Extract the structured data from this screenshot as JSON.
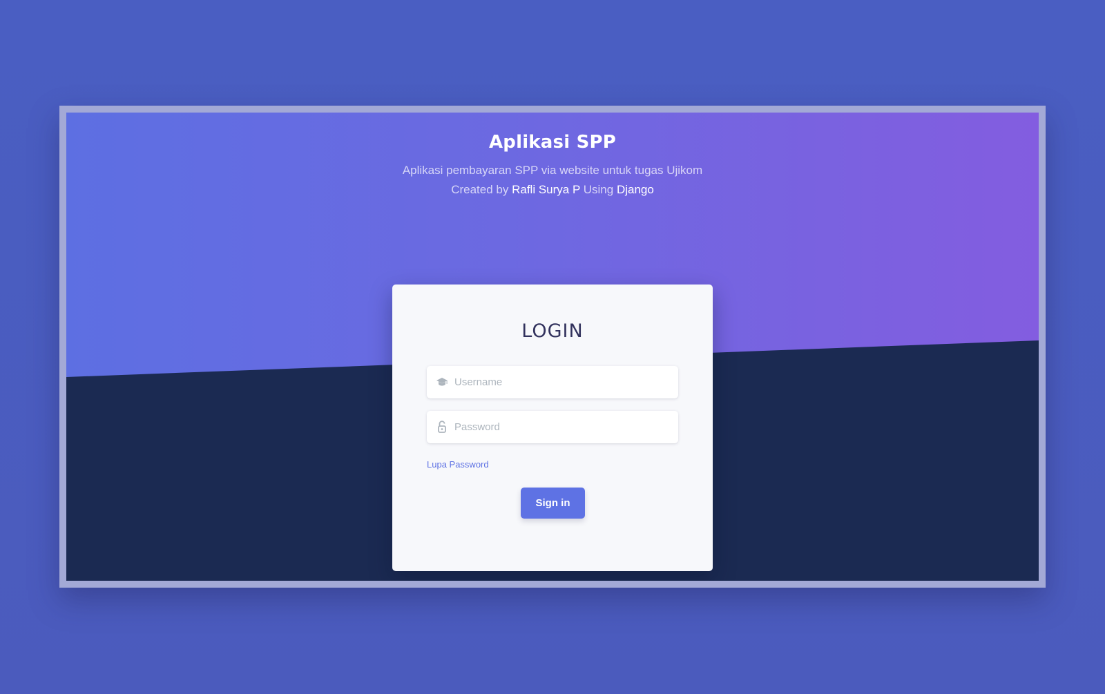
{
  "header": {
    "title": "Aplikasi SPP",
    "description": "Aplikasi pembayaran SPP via website untuk tugas Ujikom",
    "credit_prefix": "Created by",
    "author": "Rafli Surya P",
    "credit_middle": "Using",
    "framework": "Django"
  },
  "login": {
    "title": "LOGIN",
    "username_placeholder": "Username",
    "password_placeholder": "Password",
    "forgot_label": "Lupa Password",
    "signin_label": "Sign in"
  },
  "icons": {
    "username": "graduation-cap-icon",
    "password": "unlock-icon"
  },
  "colors": {
    "accent": "#5e72e4",
    "hero_start": "#5d6fe2",
    "hero_end": "#835de0",
    "dark_section": "#1b2a52",
    "card_background": "#f7f8fb",
    "page_background": "#4a5cc0"
  }
}
